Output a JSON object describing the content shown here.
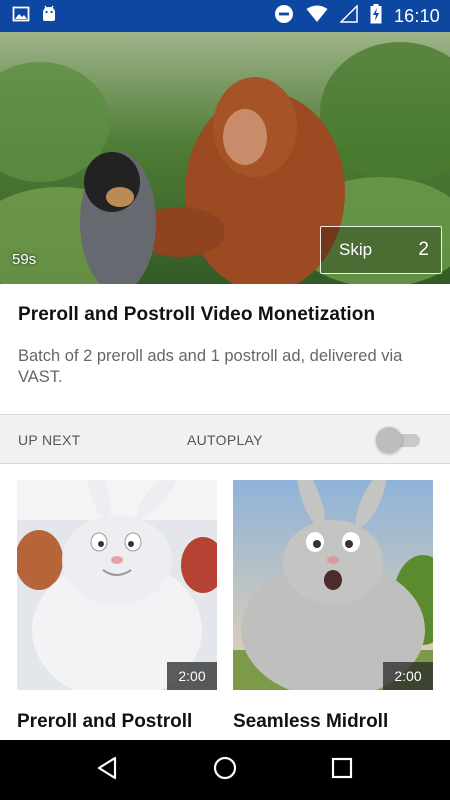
{
  "status_bar": {
    "time": "16:10",
    "icons": [
      "image-icon",
      "android-icon",
      "do-not-disturb-icon",
      "wifi-icon",
      "signal-icon",
      "battery-charging-icon"
    ]
  },
  "player": {
    "countdown": "59s",
    "skip_label": "Skip",
    "skip_count": "2"
  },
  "video": {
    "title": "Preroll and Postroll Video Monetization",
    "description": "Batch of 2 preroll ads and 1 postroll ad, delivered via VAST."
  },
  "upnext": {
    "label": "UP NEXT",
    "autoplay_label": "AUTOPLAY",
    "autoplay_on": false
  },
  "cards": [
    {
      "title": "Preroll and Postroll",
      "duration": "2:00"
    },
    {
      "title": "Seamless Midroll",
      "duration": "2:00"
    }
  ],
  "nav": {
    "icons": [
      "back-icon",
      "home-icon",
      "recents-icon"
    ]
  },
  "colors": {
    "status_bar": "#0d47a1",
    "nav_bar": "#000000"
  }
}
